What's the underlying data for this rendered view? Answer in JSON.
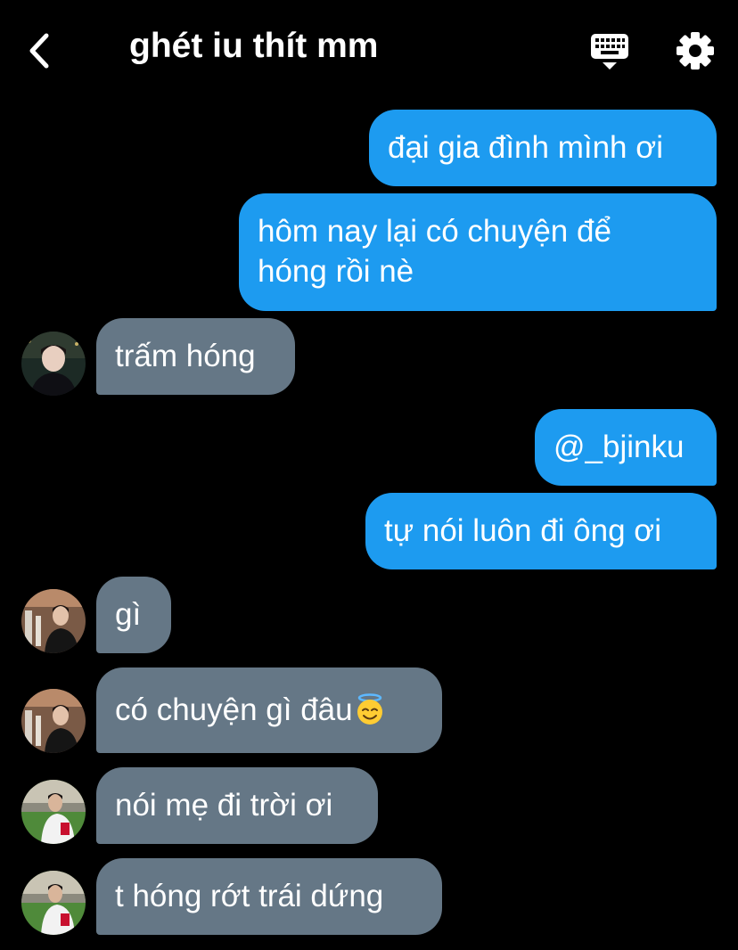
{
  "header": {
    "title": "ghét iu thít mm",
    "back_icon": "chevron-left-icon",
    "keyboard_icon": "keyboard-icon",
    "settings_icon": "gear-icon"
  },
  "colors": {
    "background": "#000000",
    "outgoing_bubble": "#1d9bf0",
    "incoming_bubble": "#657786",
    "text": "#ffffff"
  },
  "messages": [
    {
      "direction": "out",
      "text": "đại gia đình mình ơi"
    },
    {
      "direction": "out",
      "text": "hôm nay lại có chuyện để",
      "text_line2": "hóng rồi nè"
    },
    {
      "direction": "in",
      "text": "trấm hóng"
    },
    {
      "direction": "out",
      "text": "@_bjinku"
    },
    {
      "direction": "out",
      "text": "tự nói luôn đi ông ơi"
    },
    {
      "direction": "in",
      "text": "gì"
    },
    {
      "direction": "in",
      "text": "có chuyện gì đâu",
      "emoji": "smiling-face-with-halo"
    },
    {
      "direction": "in",
      "text": "nói mẹ đi trời ơi"
    },
    {
      "direction": "in",
      "text": "t hóng rớt trái dứng"
    }
  ]
}
